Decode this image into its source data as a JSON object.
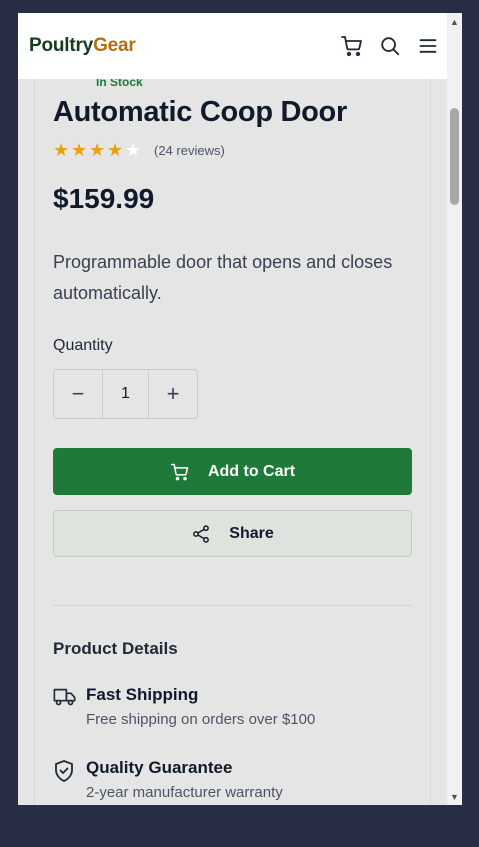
{
  "header": {
    "brand_part1": "Poultry",
    "brand_part2": "Gear",
    "icons": [
      "cart-icon",
      "search-icon",
      "menu-icon"
    ]
  },
  "product": {
    "stock_status": "In Stock",
    "title": "Automatic Coop Door",
    "rating": 4,
    "rating_max": 5,
    "reviews": "(24 reviews)",
    "price": "$159.99",
    "description": "Programmable door that opens and closes automatically."
  },
  "quantity": {
    "label": "Quantity",
    "value": "1",
    "decrement": "−",
    "increment": "+"
  },
  "actions": {
    "add_to_cart": "Add to Cart",
    "share": "Share"
  },
  "details": {
    "title": "Product Details",
    "features": [
      {
        "icon": "truck-icon",
        "title": "Fast Shipping",
        "description": "Free shipping on orders over $100"
      },
      {
        "icon": "shield-check-icon",
        "title": "Quality Guarantee",
        "description": "2-year manufacturer warranty"
      }
    ]
  },
  "colors": {
    "primary": "#1f7a3a",
    "brand_dark": "#153a1e",
    "brand_accent": "#b36f0d",
    "star": "#e8a016",
    "background": "#272d42"
  }
}
